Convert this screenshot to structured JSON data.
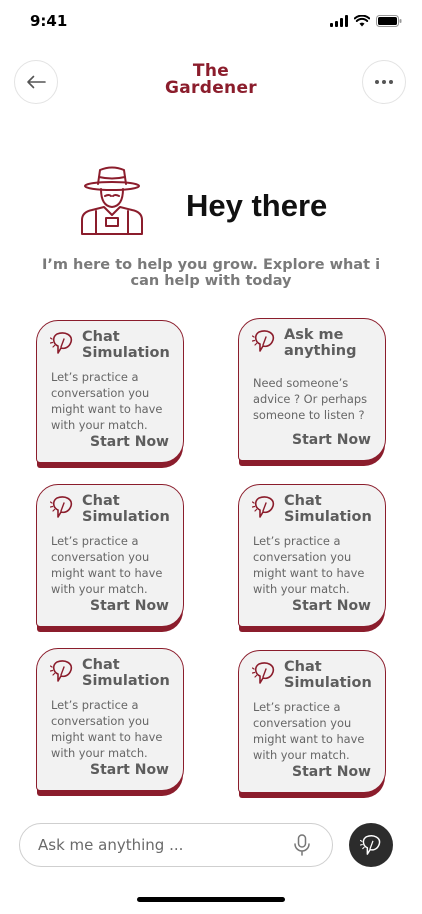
{
  "status": {
    "time": "9:41"
  },
  "header": {
    "brand_line1": "The",
    "brand_line2": "Gardener"
  },
  "hero": {
    "title": "Hey there",
    "subtitle": "I’m here to help you grow. Explore what i can help with today"
  },
  "cards": [
    {
      "title": "Chat Simulation",
      "desc": "Let’s practice a conversation you might want to have with your match.",
      "cta": "Start Now"
    },
    {
      "title": "Ask me anything",
      "desc": "Need someone’s advice ? Or perhaps someone to listen ?",
      "cta": "Start Now"
    },
    {
      "title": "Chat Simulation",
      "desc": "Let’s practice a conversation you might want to have with your match.",
      "cta": "Start Now"
    },
    {
      "title": "Chat Simulation",
      "desc": "Let’s practice a conversation you might want to have with your match.",
      "cta": "Start Now"
    },
    {
      "title": "Chat Simulation",
      "desc": "Let’s practice a conversation you might want to have with your match.",
      "cta": "Start Now"
    },
    {
      "title": "Chat Simulation",
      "desc": "Let’s practice a conversation you might want to have with your match.",
      "cta": "Start Now"
    }
  ],
  "search": {
    "placeholder": "Ask me anything ..."
  },
  "icons": {
    "back": "arrow-left-icon",
    "more": "more-horizontal-icon",
    "hero": "gardener-avatar-icon",
    "card": "sprout-chat-icon",
    "mic": "microphone-icon",
    "send": "sprout-chat-icon"
  },
  "colors": {
    "accent": "#8b1d2c",
    "card_bg": "#f2f2f2",
    "send_bg": "#2c2c2c"
  }
}
